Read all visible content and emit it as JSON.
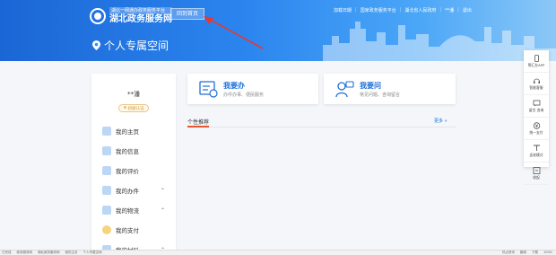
{
  "header": {
    "logo_subtitle": "湖北一网通办政务服务平台",
    "logo_title": "湖北政务服务网",
    "home_button": "回到首页",
    "top_links": [
      "加载日期",
      "国家政务服务平台",
      "湖北省人民政府",
      "**潘",
      "退出"
    ],
    "page_title": "个人专属空间",
    "colors": {
      "banner": "#2c86ef",
      "accent": "#1d6fd8",
      "annotation_arrow": "#e53935"
    }
  },
  "profile": {
    "name": "**潘",
    "badge": "初级认证",
    "menu": [
      {
        "label": "我的主页",
        "icon": "home-icon",
        "expandable": false
      },
      {
        "label": "我的信息",
        "icon": "id-card-icon",
        "expandable": false
      },
      {
        "label": "我的评价",
        "icon": "rating-icon",
        "expandable": false
      },
      {
        "label": "我的办件",
        "icon": "case-icon",
        "expandable": true
      },
      {
        "label": "我的物流",
        "icon": "truck-icon",
        "expandable": true
      },
      {
        "label": "我的支付",
        "icon": "payment-icon",
        "expandable": false
      },
      {
        "label": "我的材料",
        "icon": "folder-icon",
        "expandable": true
      }
    ]
  },
  "cards": [
    {
      "title": "我要办",
      "subtitle": "办件办事、便民服务",
      "icon": "service-icon"
    },
    {
      "title": "我要问",
      "subtitle": "常见问题、咨询留言",
      "icon": "consult-icon"
    }
  ],
  "recommend": {
    "title": "个性推荐",
    "more": "更多 »"
  },
  "float_bar": [
    {
      "label": "鄂汇办APP",
      "icon": "phone-icon"
    },
    {
      "label": "智能客服",
      "icon": "headset-icon"
    },
    {
      "label": "留言 咨询",
      "icon": "message-icon"
    },
    {
      "label": "统一支付",
      "icon": "yen-icon"
    },
    {
      "label": "适老模式",
      "icon": "font-size-icon"
    },
    {
      "label": "收起",
      "icon": "collapse-icon"
    }
  ],
  "statusbar": {
    "left": [
      "已完成",
      "政务服务网",
      "湖北政务服务网",
      "我的主页",
      "个人专属空间"
    ],
    "right": [
      "热点资讯",
      "翻译",
      "下载",
      "100%"
    ]
  }
}
